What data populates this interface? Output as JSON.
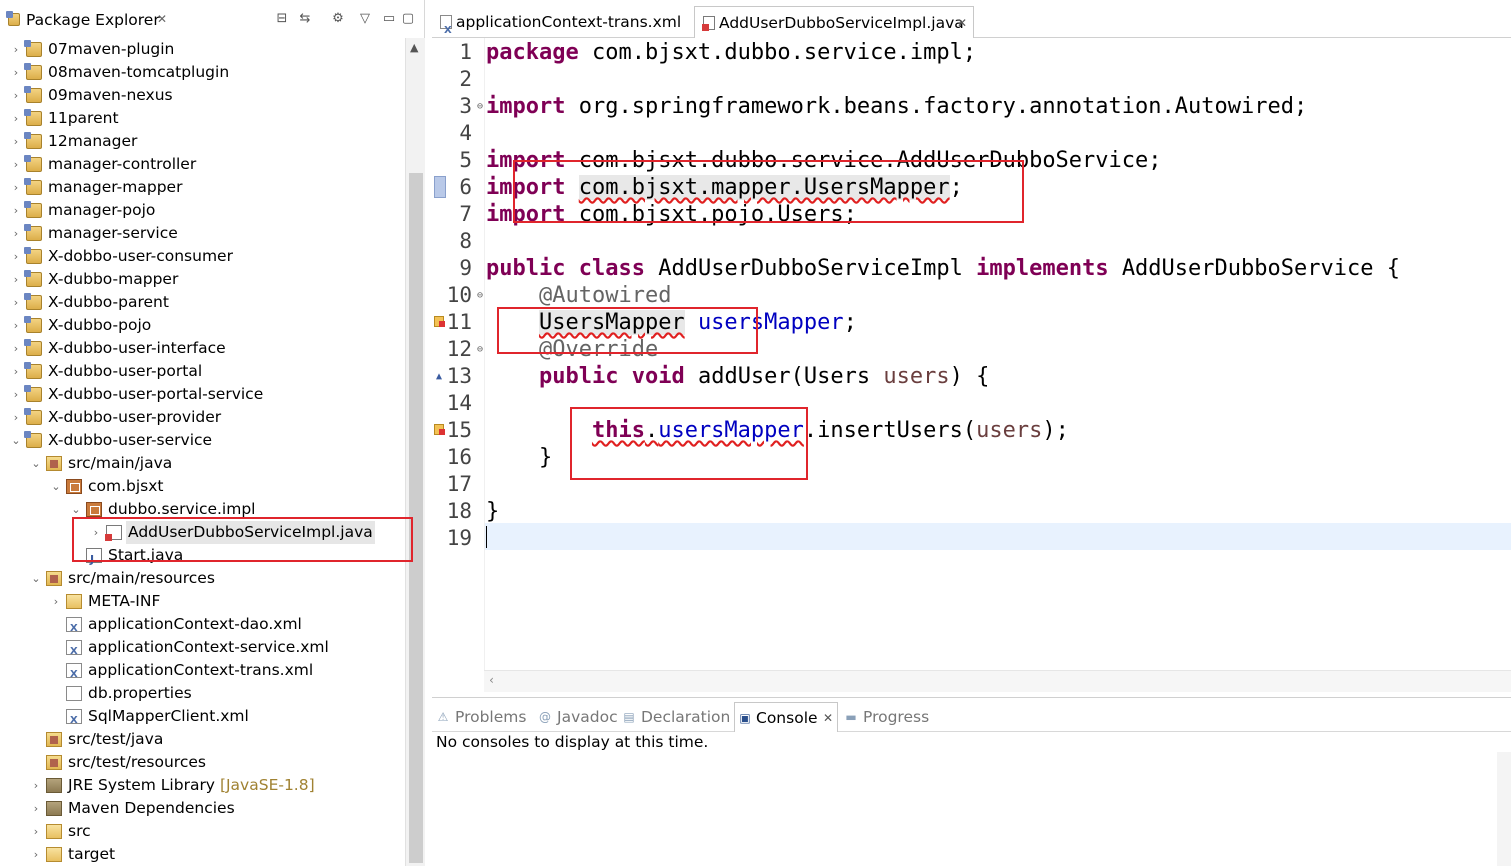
{
  "explorer": {
    "title": "Package Explorer",
    "tree": [
      {
        "label": "07maven-plugin",
        "icon": "maven-project-icon",
        "level": 0,
        "twisty": "›"
      },
      {
        "label": "08maven-tomcatplugin",
        "icon": "maven-project-icon",
        "level": 0,
        "twisty": "›"
      },
      {
        "label": "09maven-nexus",
        "icon": "maven-project-icon",
        "level": 0,
        "twisty": "›"
      },
      {
        "label": "11parent",
        "icon": "maven-project-icon",
        "level": 0,
        "twisty": "›"
      },
      {
        "label": "12manager",
        "icon": "maven-project-icon",
        "level": 0,
        "twisty": "›"
      },
      {
        "label": "manager-controller",
        "icon": "maven-project-icon",
        "level": 0,
        "twisty": "›"
      },
      {
        "label": "manager-mapper",
        "icon": "maven-project-icon",
        "level": 0,
        "twisty": "›"
      },
      {
        "label": "manager-pojo",
        "icon": "maven-project-icon",
        "level": 0,
        "twisty": "›"
      },
      {
        "label": "manager-service",
        "icon": "maven-project-icon",
        "level": 0,
        "twisty": "›"
      },
      {
        "label": "X-dobbo-user-consumer",
        "icon": "maven-project-icon",
        "level": 0,
        "twisty": "›"
      },
      {
        "label": "X-dubbo-mapper",
        "icon": "maven-project-icon",
        "level": 0,
        "twisty": "›"
      },
      {
        "label": "X-dubbo-parent",
        "icon": "maven-project-icon",
        "level": 0,
        "twisty": "›"
      },
      {
        "label": "X-dubbo-pojo",
        "icon": "maven-project-icon",
        "level": 0,
        "twisty": "›"
      },
      {
        "label": "X-dubbo-user-interface",
        "icon": "maven-project-icon",
        "level": 0,
        "twisty": "›"
      },
      {
        "label": "X-dubbo-user-portal",
        "icon": "maven-project-icon",
        "level": 0,
        "twisty": "›"
      },
      {
        "label": "X-dubbo-user-portal-service",
        "icon": "maven-project-icon",
        "level": 0,
        "twisty": "›"
      },
      {
        "label": "X-dubbo-user-provider",
        "icon": "maven-project-icon",
        "level": 0,
        "twisty": "›"
      },
      {
        "label": "X-dubbo-user-service",
        "icon": "maven-project-icon",
        "level": 0,
        "twisty": "⌄"
      },
      {
        "label": "src/main/java",
        "icon": "source-folder-icon",
        "level": 1,
        "twisty": "⌄"
      },
      {
        "label": "com.bjsxt",
        "icon": "package-icon",
        "level": 2,
        "twisty": "⌄"
      },
      {
        "label": "dubbo.service.impl",
        "icon": "package-icon",
        "level": 3,
        "twisty": "⌄"
      },
      {
        "label": "AddUserDubboServiceImpl.java",
        "icon": "java-file-error-icon",
        "level": 4,
        "twisty": "›",
        "selected": true
      },
      {
        "label": "Start.java",
        "icon": "java-file-icon",
        "level": 3,
        "twisty": ""
      },
      {
        "label": "src/main/resources",
        "icon": "source-folder-icon",
        "level": 1,
        "twisty": "⌄"
      },
      {
        "label": "META-INF",
        "icon": "folder-icon",
        "level": 2,
        "twisty": "›"
      },
      {
        "label": "applicationContext-dao.xml",
        "icon": "xml-file-icon",
        "level": 2,
        "twisty": ""
      },
      {
        "label": "applicationContext-service.xml",
        "icon": "xml-file-icon",
        "level": 2,
        "twisty": ""
      },
      {
        "label": "applicationContext-trans.xml",
        "icon": "xml-file-icon",
        "level": 2,
        "twisty": ""
      },
      {
        "label": "db.properties",
        "icon": "file-icon",
        "level": 2,
        "twisty": ""
      },
      {
        "label": "SqlMapperClient.xml",
        "icon": "xml-file-icon",
        "level": 2,
        "twisty": ""
      },
      {
        "label": "src/test/java",
        "icon": "source-folder-icon",
        "level": 1,
        "twisty": ""
      },
      {
        "label": "src/test/resources",
        "icon": "source-folder-icon",
        "level": 1,
        "twisty": ""
      },
      {
        "label": "JRE System Library",
        "decoration": "[JavaSE-1.8]",
        "icon": "library-icon",
        "level": 1,
        "twisty": "›"
      },
      {
        "label": "Maven Dependencies",
        "icon": "library-icon",
        "level": 1,
        "twisty": "›"
      },
      {
        "label": "src",
        "icon": "folder-icon",
        "level": 1,
        "twisty": "›"
      },
      {
        "label": "target",
        "icon": "folder-icon",
        "level": 1,
        "twisty": "›"
      }
    ]
  },
  "editor": {
    "tabs": [
      {
        "label": "applicationContext-trans.xml",
        "icon": "xml-file-icon",
        "active": false
      },
      {
        "label": "AddUserDubboServiceImpl.java",
        "icon": "java-file-error-icon",
        "active": true
      }
    ],
    "lines": [
      {
        "n": "1",
        "tokens": [
          [
            "kw",
            "package"
          ],
          [
            "",
            "com.bjsxt.dubbo.service.impl;"
          ]
        ]
      },
      {
        "n": "2",
        "tokens": []
      },
      {
        "n": "3",
        "fold": true,
        "tokens": [
          [
            "kw",
            "import"
          ],
          [
            "",
            "org.springframework.beans.factory.annotation.Autowired;"
          ]
        ]
      },
      {
        "n": "4",
        "tokens": []
      },
      {
        "n": "5",
        "tokens": [
          [
            "kw",
            "import"
          ],
          [
            "",
            "com.bjsxt.dubbo.service.AddUserDubboService;"
          ]
        ]
      },
      {
        "n": "6",
        "marker": "error-big",
        "tokens": [
          [
            "kw",
            "import"
          ],
          [
            "",
            " "
          ],
          [
            "hl err",
            "com.bjsxt.mapper.UsersMapper"
          ],
          [
            "",
            ";"
          ]
        ]
      },
      {
        "n": "7",
        "tokens": [
          [
            "kw",
            "import"
          ],
          [
            "",
            "com.bjsxt.pojo.Users;"
          ]
        ]
      },
      {
        "n": "8",
        "tokens": []
      },
      {
        "n": "9",
        "tokens": [
          [
            "kw",
            "public"
          ],
          [
            "",
            " "
          ],
          [
            "kw",
            "class"
          ],
          [
            "",
            "AddUserDubboServiceImpl"
          ],
          [
            "",
            " "
          ],
          [
            "kw",
            "implements"
          ],
          [
            "",
            "AddUserDubboService {"
          ]
        ]
      },
      {
        "n": "10",
        "fold": true,
        "tokens": [
          [
            "",
            "    "
          ],
          [
            "ann",
            "@Autowired"
          ]
        ]
      },
      {
        "n": "11",
        "marker": "error",
        "tokens": [
          [
            "",
            "    "
          ],
          [
            "hl err",
            "UsersMapper"
          ],
          [
            "",
            " "
          ],
          [
            "fld",
            "usersMapper"
          ],
          [
            "",
            ";"
          ]
        ]
      },
      {
        "n": "12",
        "fold": true,
        "tokens": [
          [
            "",
            "    "
          ],
          [
            "ann",
            "@Override"
          ]
        ]
      },
      {
        "n": "13",
        "marker": "override",
        "tokens": [
          [
            "",
            "    "
          ],
          [
            "kw",
            "public"
          ],
          [
            "",
            " "
          ],
          [
            "kw",
            "void"
          ],
          [
            "",
            "addUser(Users "
          ],
          [
            "par",
            "users"
          ],
          [
            "",
            ") {"
          ]
        ]
      },
      {
        "n": "14",
        "tokens": []
      },
      {
        "n": "15",
        "marker": "error",
        "tokens": [
          [
            "",
            "        "
          ],
          [
            "kw err",
            "this"
          ],
          [
            "err",
            "."
          ],
          [
            "fld err",
            "usersMapper"
          ],
          [
            "",
            ".insertUsers("
          ],
          [
            "par",
            "users"
          ],
          [
            "",
            ");"
          ]
        ]
      },
      {
        "n": "16",
        "tokens": [
          [
            "",
            "    }"
          ]
        ]
      },
      {
        "n": "17",
        "tokens": []
      },
      {
        "n": "18",
        "tokens": [
          [
            "",
            "}"
          ]
        ]
      },
      {
        "n": "19",
        "tokens": []
      }
    ]
  },
  "bottom": {
    "tabs": [
      {
        "label": "Problems",
        "icon": "problems-icon",
        "active": false
      },
      {
        "label": "Javadoc",
        "icon": "javadoc-icon",
        "active": false
      },
      {
        "label": "Declaration",
        "icon": "declaration-icon",
        "active": false
      },
      {
        "label": "Console",
        "icon": "console-icon",
        "active": true
      },
      {
        "label": "Progress",
        "icon": "progress-icon",
        "active": false
      }
    ],
    "console_message": "No consoles to display at this time."
  },
  "colors": {
    "keyword": "#7f0055",
    "field": "#0000c0",
    "annotation": "#646464",
    "parameter": "#6a3e3e",
    "annotation_box": "#e0252c"
  }
}
